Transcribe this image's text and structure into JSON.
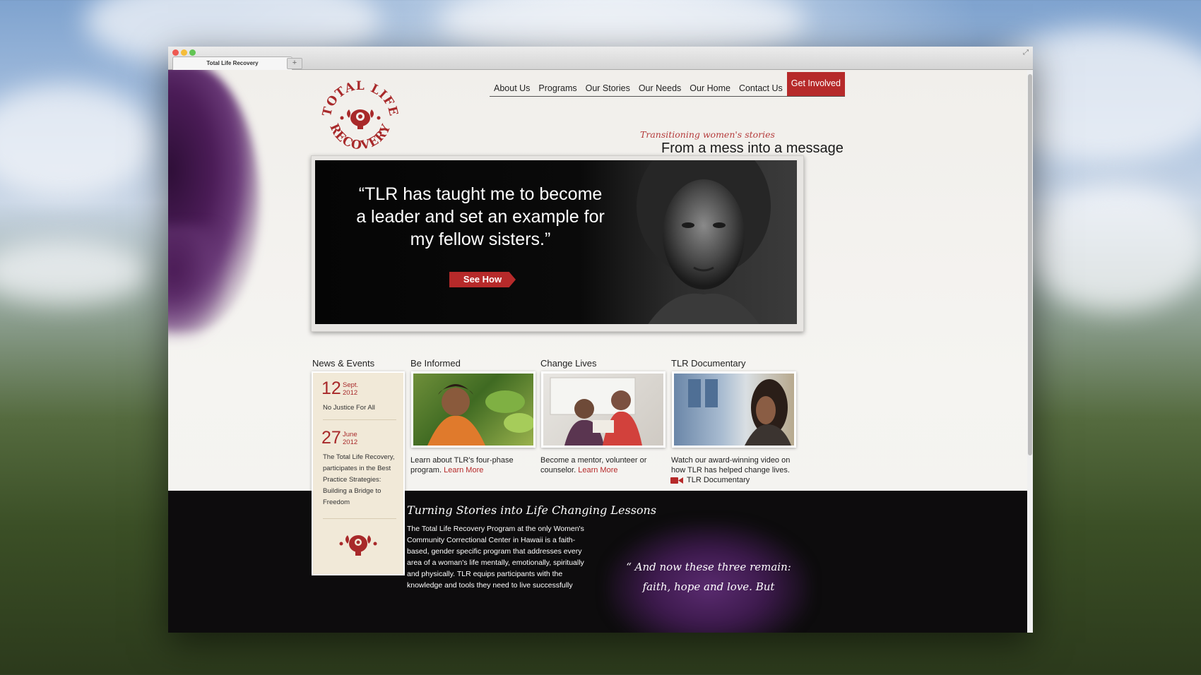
{
  "browser": {
    "tab_title": "Total Life Recovery",
    "new_tab": "+"
  },
  "nav": {
    "items": [
      "About Us",
      "Programs",
      "Our Stories",
      "Our Needs",
      "Our Home",
      "Contact Us"
    ],
    "cta": "Get Involved"
  },
  "logo": {
    "top_text": "TOTAL LIFE",
    "bottom_text": "RECOVERY"
  },
  "tagline": {
    "script": "Transitioning women's stories",
    "main": "From a mess into a message"
  },
  "hero": {
    "quote": "“TLR has taught me to become a leader and set an example for my fellow sisters.”",
    "button": "See How"
  },
  "news": {
    "title": "News & Events",
    "items": [
      {
        "day": "12",
        "month": "Sept.",
        "year": "2012",
        "text": "No Justice For All"
      },
      {
        "day": "27",
        "month": "June",
        "year": "2012",
        "text": "The Total Life Recovery, participates in the Best Practice Strategies: Building a Bridge to Freedom"
      }
    ]
  },
  "columns": {
    "informed": {
      "title": "Be Informed",
      "text": "Learn about TLR's four-phase program.",
      "link": "Learn More"
    },
    "change": {
      "title": "Change Lives",
      "text": "Become a mentor, volunteer or counselor.",
      "link": "Learn More"
    },
    "documentary": {
      "title": "TLR Documentary",
      "text": "Watch our award-winning video on how TLR has helped change lives.",
      "link": "TLR Documentary"
    }
  },
  "band": {
    "title": "Turning Stories into Life Changing Lessons",
    "text": "The Total Life Recovery Program at the only Women's Community Correctional Center in Hawaii is a faith-based, gender specific program that addresses every area of a woman's life mentally, emotionally, spiritually and physically. TLR equips participants with the knowledge and tools they need to live successfully",
    "quote": "“ And now these three remain: faith, hope and love. But"
  },
  "colors": {
    "accent": "#b62a2a",
    "ink": "#4b1c57",
    "band": "#0d0c0d"
  }
}
